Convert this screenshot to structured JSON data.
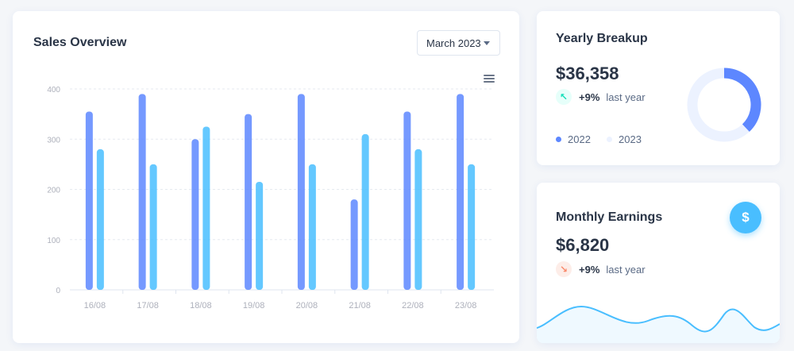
{
  "sales_overview": {
    "title": "Sales Overview",
    "period_select": "March 2023",
    "menu_icon": "hamburger-menu-icon"
  },
  "chart_data": {
    "type": "bar",
    "categories": [
      "16/08",
      "17/08",
      "18/08",
      "19/08",
      "20/08",
      "21/08",
      "22/08",
      "23/08"
    ],
    "series": [
      {
        "values": [
          355,
          390,
          300,
          350,
          390,
          180,
          355,
          390
        ],
        "color": "#5d87ff"
      },
      {
        "values": [
          280,
          250,
          325,
          215,
          250,
          310,
          280,
          250
        ],
        "color": "#49beff"
      }
    ],
    "yticks": [
      0,
      100,
      200,
      300,
      400
    ],
    "ylim": [
      0,
      400
    ],
    "grid": true
  },
  "yearly_breakup": {
    "title": "Yearly Breakup",
    "amount": "$36,358",
    "trend_icon": "arrow-up-left-icon",
    "trend_percent": "+9%",
    "trend_label": "last year",
    "legend": [
      {
        "label": "2022",
        "color": "#5d87ff"
      },
      {
        "label": "2023",
        "color": "#ecf2ff"
      }
    ]
  },
  "donut_data": {
    "type": "pie",
    "slices": [
      {
        "label": "2022",
        "value": 38,
        "color": "#5d87ff"
      },
      {
        "label": "2023",
        "value": 62,
        "color": "#ecf2ff"
      }
    ]
  },
  "monthly_earnings": {
    "title": "Monthly Earnings",
    "amount": "$6,820",
    "trend_icon": "arrow-down-right-icon",
    "trend_percent": "+9%",
    "trend_label": "last year",
    "button_icon": "dollar-icon",
    "button_symbol": "$",
    "sparkline_color": "#49beff"
  }
}
